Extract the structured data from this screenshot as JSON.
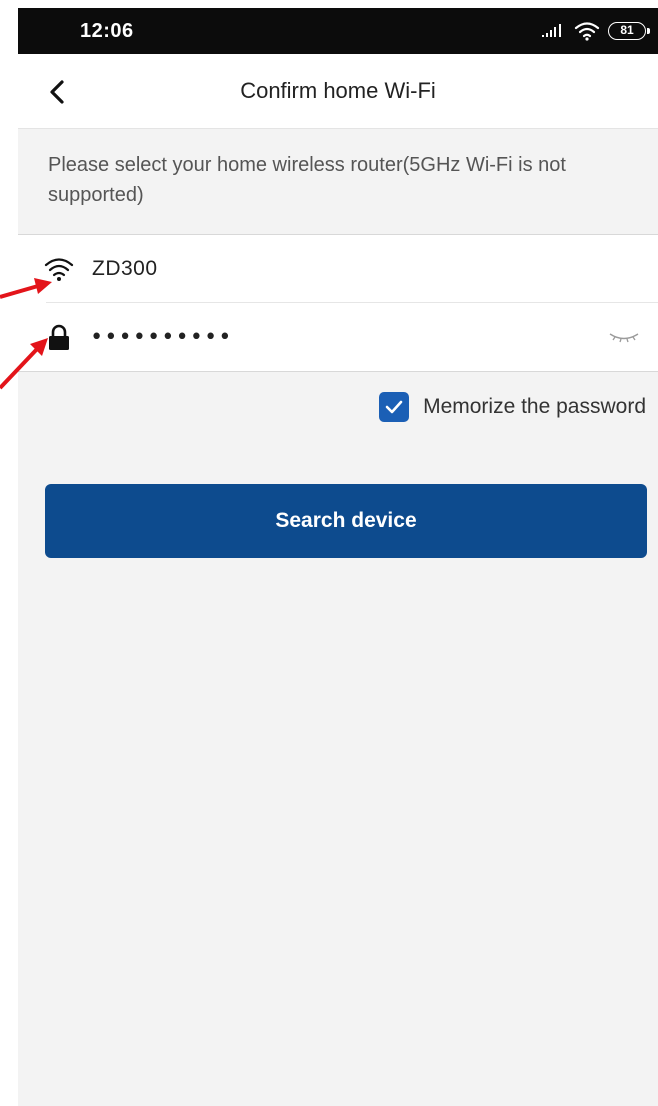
{
  "status_bar": {
    "time": "12:06",
    "battery": "81",
    "icons": [
      "signal-icon",
      "wifi-icon",
      "battery-icon"
    ]
  },
  "header": {
    "title": "Confirm home Wi-Fi",
    "back_icon": "chevron-left-icon"
  },
  "hint": "Please select your home wireless router(5GHz Wi-Fi is not supported)",
  "wifi_form": {
    "ssid": "ZD300",
    "ssid_icon": "wifi-icon",
    "password_value": "••••••••••",
    "password_icon": "lock-icon",
    "toggle_icon": "eye-closed-icon"
  },
  "memorize": {
    "label": "Memorize the password",
    "checked": true
  },
  "search_button": {
    "label": "Search device"
  },
  "annotations": {
    "arrow_color": "#e3141a"
  },
  "colors": {
    "accent": "#0d4b8e",
    "checkbox": "#1b5fb5",
    "background": "#f3f3f3"
  }
}
